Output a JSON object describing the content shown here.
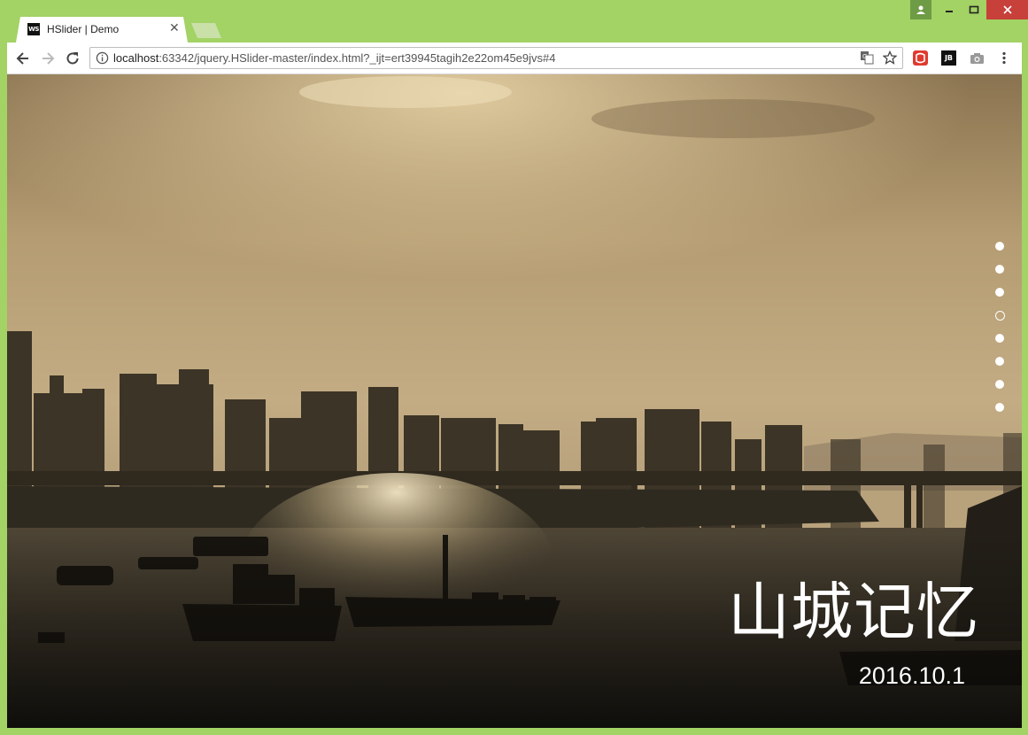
{
  "browser": {
    "tab": {
      "favicon_text": "WS",
      "title": "HSlider | Demo"
    },
    "url": {
      "host": "localhost",
      "rest": ":63342/jquery.HSlider-master/index.html?_ijt=ert39945tagih2e22om45e9jvs#4"
    },
    "window_controls": [
      "user-icon",
      "minimize-icon",
      "maximize-icon",
      "close-icon"
    ],
    "toolbar_icons": [
      "back-icon",
      "forward-icon",
      "reload-icon",
      "info-icon",
      "translate-icon",
      "star-icon"
    ],
    "extensions": [
      "red-extension-icon",
      "jetbrains-extension-icon",
      "camera-icon",
      "menu-icon"
    ],
    "ext_labels": {
      "jetbrains": "JB"
    }
  },
  "slider": {
    "title": "山城记忆",
    "date": "2016.10.1",
    "dots_total": 8,
    "active_index": 4
  },
  "colors": {
    "frame": "#a3d265",
    "close_button": "#c8403a",
    "user_button": "#6e9b45"
  }
}
